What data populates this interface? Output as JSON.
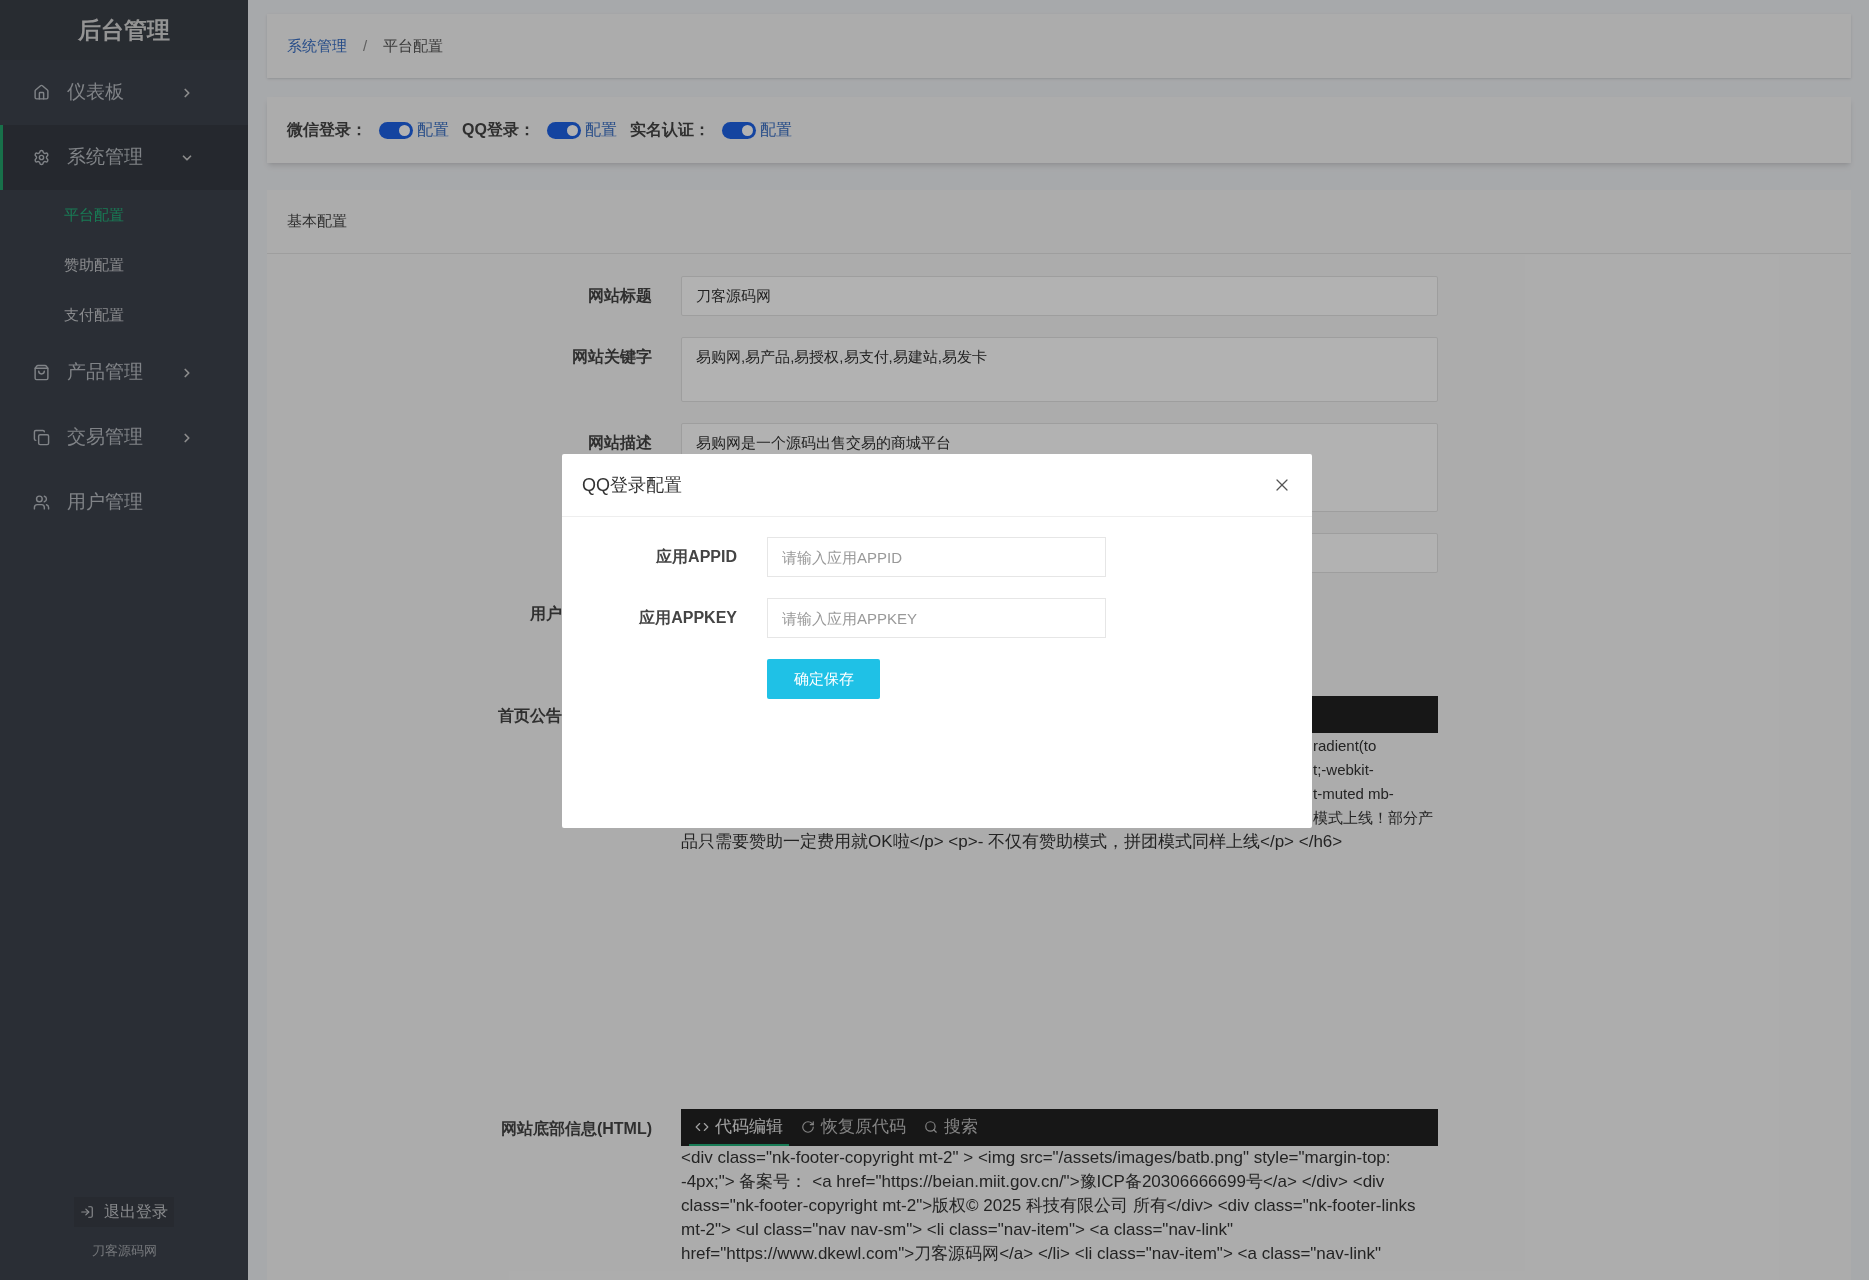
{
  "sidebar": {
    "title": "后台管理",
    "menu": [
      {
        "label": "仪表板",
        "kind": "group",
        "expanded": false
      },
      {
        "label": "系统管理",
        "kind": "group",
        "expanded": true,
        "children": [
          {
            "label": "平台配置",
            "selected": true
          },
          {
            "label": "赞助配置",
            "selected": false
          },
          {
            "label": "支付配置",
            "selected": false
          }
        ]
      },
      {
        "label": "产品管理",
        "kind": "group",
        "expanded": false
      },
      {
        "label": "交易管理",
        "kind": "group",
        "expanded": false
      },
      {
        "label": "用户管理",
        "kind": "link"
      }
    ],
    "logout": "退出登录",
    "footer": "刀客源码网"
  },
  "breadcrumb": {
    "items": [
      {
        "label": "系统管理",
        "kind": "link"
      },
      {
        "label": "平台配置",
        "kind": "current"
      }
    ],
    "separator": "/"
  },
  "switches": [
    {
      "label": "微信登录：",
      "on": true,
      "link": "配置"
    },
    {
      "label": "QQ登录：",
      "on": true,
      "link": "配置"
    },
    {
      "label": "实名认证：",
      "on": true,
      "link": "配置"
    }
  ],
  "basic_config": {
    "title": "基本配置",
    "fields": [
      {
        "kind": "input",
        "label": "网站标题",
        "value": "刀客源码网"
      },
      {
        "kind": "textarea",
        "label": "网站关键字",
        "value": "易购网,易产品,易授权,易支付,易建站,易发卡"
      },
      {
        "kind": "textarea",
        "label": "网站描述",
        "value": "易购网是一个源码出售交易的商城平台"
      },
      {
        "kind": "input"
      },
      {
        "kind": "hidden_control",
        "label": "用户"
      },
      {
        "kind": "covered_editor",
        "label": "首页公告",
        "fragments": [
          "radient(to",
          "t;-webkit-",
          "t-muted mb-",
          "模式上线！部分产"
        ],
        "text": "品只需要赞助一定费用就OK啦</p> <p>- 不仅有赞助模式，拼团模式同样上线</p> </h6>"
      },
      {
        "kind": "editor",
        "label": "网站底部信息(HTML)",
        "toolbar": [
          {
            "label": "代码编辑",
            "selected": true
          },
          {
            "label": "恢复原代码",
            "selected": false
          },
          {
            "label": "搜索",
            "selected": false
          }
        ],
        "text": "<div class=\"nk-footer-copyright mt-2\" > <img src=\"/assets/images/batb.png\" style=\"margin-top: -4px;\"> 备案号： <a href=\"https://beian.miit.gov.cn/\">豫ICP备20306666699号</a> </div> <div class=\"nk-footer-copyright mt-2\">版权© 2025 科技有限公司 所有</div> <div class=\"nk-footer-links mt-2\"> <ul class=\"nav nav-sm\"> <li class=\"nav-item\"> <a class=\"nav-link\" href=\"https://www.dkewl.com\">刀客源码网</a> </li> <li class=\"nav-item\"> <a class=\"nav-link\""
      }
    ]
  },
  "modal": {
    "title": "QQ登录配置",
    "fields": [
      {
        "label": "应用APPID",
        "placeholder": "请输入应用APPID"
      },
      {
        "label": "应用APPKEY",
        "placeholder": "请输入应用APPKEY"
      }
    ],
    "submit": "确定保存"
  }
}
